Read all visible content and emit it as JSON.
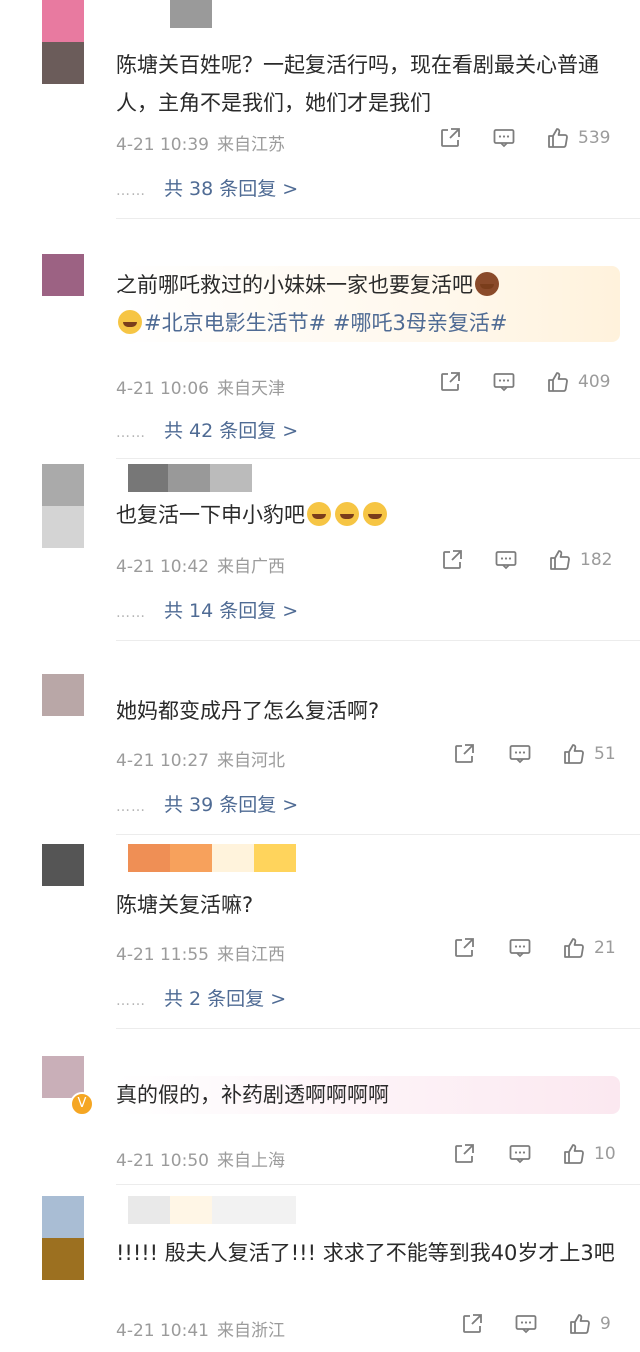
{
  "comments": [
    {
      "text": "陈塘关百姓呢？一起复活行吗，现在看剧最关心普通人，主角不是我们，她们才是我们",
      "date": "4-21 10:39",
      "location": "来自江苏",
      "likes": "539",
      "replies_label": "共 38 条回复 >"
    },
    {
      "text": "之前哪吒救过的小妹妹一家也要复活吧",
      "tag1": "#北京电影生活节#",
      "tag2": "#哪吒3母亲复活#",
      "date": "4-21 10:06",
      "location": "来自天津",
      "likes": "409",
      "replies_label": "共 42 条回复 >"
    },
    {
      "text": "也复活一下申小豹吧",
      "date": "4-21 10:42",
      "location": "来自广西",
      "likes": "182",
      "replies_label": "共 14 条回复 >"
    },
    {
      "text": "她妈都变成丹了怎么复活啊?",
      "date": "4-21 10:27",
      "location": "来自河北",
      "likes": "51",
      "replies_label": "共 39 条回复 >"
    },
    {
      "text": "陈塘关复活嘛?",
      "date": "4-21 11:55",
      "location": "来自江西",
      "likes": "21",
      "replies_label": "共 2 条回复 >"
    },
    {
      "text": "真的假的，补药剧透啊啊啊啊",
      "date": "4-21 10:50",
      "location": "来自上海",
      "likes": "10"
    },
    {
      "text": "!!!!! 殷夫人复活了!!! 求求了不能等到我40岁才上3吧",
      "date": "4-21 10:41",
      "location": "来自浙江",
      "likes": "9"
    }
  ],
  "reply_dots": "……",
  "icons": {
    "share": "share-icon",
    "comment": "comment-icon",
    "like": "thumbs-up-icon",
    "verified": "verified-badge-icon"
  },
  "colors": {
    "link": "#4f6b94",
    "meta": "#9b9b9b",
    "text": "#2a2a2a"
  }
}
